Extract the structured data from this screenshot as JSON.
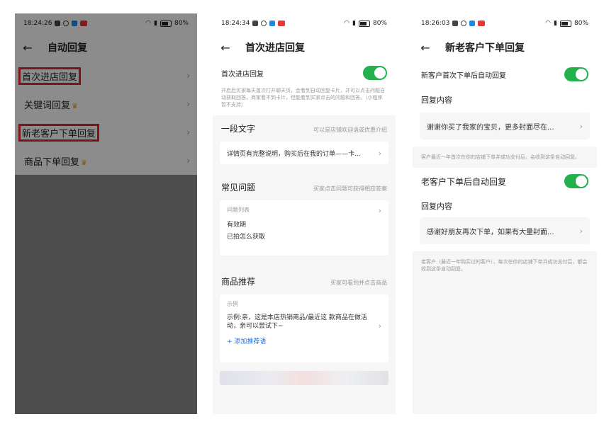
{
  "screen1": {
    "status": {
      "time": "18:24:26",
      "battery": "80%"
    },
    "title": "自动回复",
    "items": [
      {
        "label": "首次进店回复",
        "crown": false
      },
      {
        "label": "关键词回复",
        "crown": true
      },
      {
        "label": "新老客户下单回复",
        "crown": false
      },
      {
        "label": "商品下单回复",
        "crown": true
      }
    ]
  },
  "screen2": {
    "status": {
      "time": "18:24:34",
      "battery": "80%"
    },
    "title": "首次进店回复",
    "toggle_label": "首次进店回复",
    "toggle_hint": "开启后买家每天首次打开聊天页，会看到自动回复卡片，并可以点击问题自动获取回答。商家看不到卡片，但能看到买家点击的问题和回答。（小程序暂不支持）",
    "text_section": {
      "title": "一段文字",
      "sub": "可以是店铺欢迎语或优惠介绍",
      "value": "详情页有完整说明，购买后在我的订单——卡..."
    },
    "faq_section": {
      "title": "常见问题",
      "sub": "买家点击问题可获得相应答案",
      "list_label": "问题列表",
      "questions": [
        "有效期",
        "已拍怎么获取"
      ]
    },
    "product_section": {
      "title": "商品推荐",
      "sub": "买家可看到并点击商品",
      "example_label": "示例",
      "example_text": "示例:亲，这是本店热销商品/最近这 款商品在做活动，亲可以尝试下~",
      "add_link": "+ 添加推荐语"
    }
  },
  "screen3": {
    "status": {
      "time": "18:26:03",
      "battery": "80%"
    },
    "title": "新老客户下单回复",
    "new_customer": {
      "toggle_label": "新客户首次下单后自动回复",
      "content_title": "回复内容",
      "content_value": "谢谢你买了我家的宝贝，更多封面尽在...",
      "hint": "客户最近一年首次在你的店铺下单并成功支付后，会收到这条自动回复。"
    },
    "old_customer": {
      "toggle_label": "老客户下单后自动回复",
      "content_title": "回复内容",
      "content_value": "感谢好朋友再次下单，如果有大量封面...",
      "hint": "老客户（最近一年购买过的客户），每次在你的店铺下单并成功支付后，都会收到这条自动回复。"
    }
  }
}
